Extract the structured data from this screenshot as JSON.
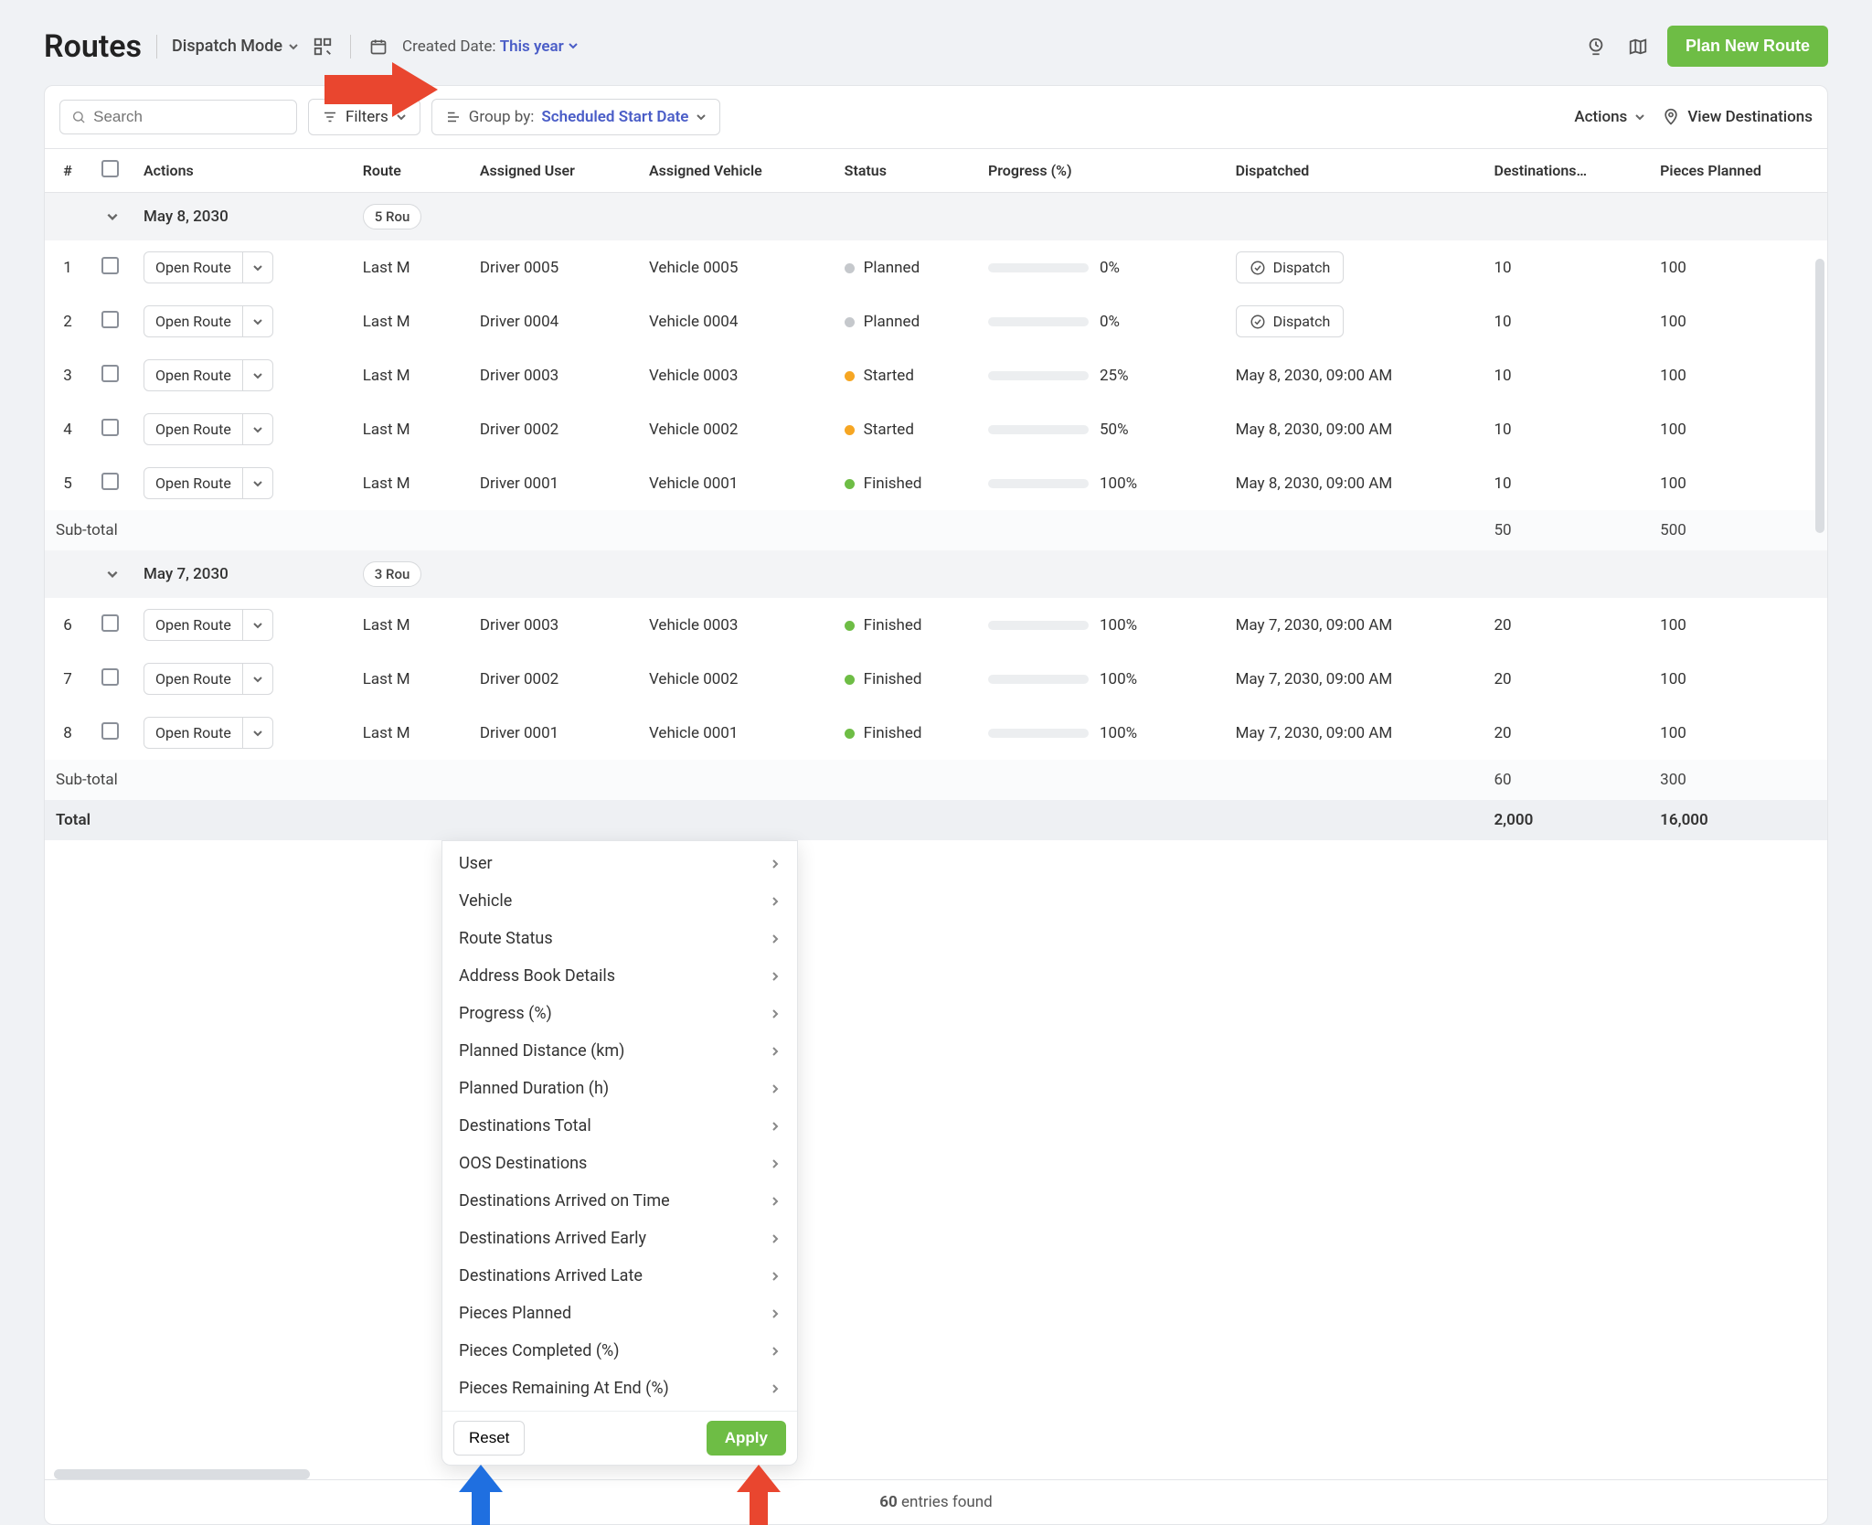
{
  "header": {
    "title": "Routes",
    "dispatch_mode": "Dispatch Mode",
    "created_date_label": "Created Date:",
    "created_date_value": "This year",
    "plan_button": "Plan New Route"
  },
  "toolbar": {
    "search_placeholder": "Search",
    "filters_label": "Filters",
    "groupby_label": "Group by:",
    "groupby_value": "Scheduled Start Date",
    "actions_label": "Actions",
    "view_dest_label": "View Destinations"
  },
  "columns": {
    "num": "#",
    "actions": "Actions",
    "route": "Route",
    "assigned_user": "Assigned User",
    "assigned_vehicle": "Assigned Vehicle",
    "status": "Status",
    "progress": "Progress (%)",
    "dispatched": "Dispatched",
    "destinations": "Destinations…",
    "pieces_planned": "Pieces Planned"
  },
  "filter_menu": {
    "items": [
      "User",
      "Vehicle",
      "Route Status",
      "Address Book Details",
      "Progress (%)",
      "Planned Distance (km)",
      "Planned Duration (h)",
      "Destinations Total",
      "OOS Destinations",
      "Destinations Arrived on Time",
      "Destinations Arrived Early",
      "Destinations Arrived Late",
      "Pieces Planned",
      "Pieces Completed (%)",
      "Pieces Remaining At End (%)"
    ],
    "reset": "Reset",
    "apply": "Apply"
  },
  "groups": [
    {
      "date": "May 8, 2030",
      "count_label": "5 Rou",
      "rows": [
        {
          "n": 1,
          "open": "Open Route",
          "route": "Last M",
          "user": "Driver 0005",
          "vehicle": "Vehicle 0005",
          "status": "Planned",
          "status_dot": "grey",
          "progress": 0,
          "progress_label": "0%",
          "dispatched_btn": "Dispatch",
          "dest": 10,
          "pieces": 100
        },
        {
          "n": 2,
          "open": "Open Route",
          "route": "Last M",
          "user": "Driver 0004",
          "vehicle": "Vehicle 0004",
          "status": "Planned",
          "status_dot": "grey",
          "progress": 0,
          "progress_label": "0%",
          "dispatched_btn": "Dispatch",
          "dest": 10,
          "pieces": 100
        },
        {
          "n": 3,
          "open": "Open Route",
          "route": "Last M",
          "user": "Driver 0003",
          "vehicle": "Vehicle 0003",
          "status": "Started",
          "status_dot": "orange",
          "progress": 25,
          "progress_label": "25%",
          "dispatched": "May 8, 2030, 09:00 AM",
          "dest": 10,
          "pieces": 100
        },
        {
          "n": 4,
          "open": "Open Route",
          "route": "Last M",
          "user": "Driver 0002",
          "vehicle": "Vehicle 0002",
          "status": "Started",
          "status_dot": "orange",
          "progress": 50,
          "progress_label": "50%",
          "dispatched": "May 8, 2030, 09:00 AM",
          "dest": 10,
          "pieces": 100
        },
        {
          "n": 5,
          "open": "Open Route",
          "route": "Last M",
          "user": "Driver 0001",
          "vehicle": "Vehicle 0001",
          "status": "Finished",
          "status_dot": "green",
          "progress": 100,
          "progress_label": "100%",
          "dispatched": "May 8, 2030, 09:00 AM",
          "dest": 10,
          "pieces": 100
        }
      ],
      "subtotal": {
        "label": "Sub-total",
        "dest": 50,
        "pieces": 500
      }
    },
    {
      "date": "May 7, 2030",
      "count_label": "3 Rou",
      "rows": [
        {
          "n": 6,
          "open": "Open Route",
          "route": "Last M",
          "user": "Driver 0003",
          "vehicle": "Vehicle 0003",
          "status": "Finished",
          "status_dot": "green",
          "progress": 100,
          "progress_label": "100%",
          "dispatched": "May 7, 2030, 09:00 AM",
          "dest": 20,
          "pieces": 100
        },
        {
          "n": 7,
          "open": "Open Route",
          "route": "Last M",
          "user": "Driver 0002",
          "vehicle": "Vehicle 0002",
          "status": "Finished",
          "status_dot": "green",
          "progress": 100,
          "progress_label": "100%",
          "dispatched": "May 7, 2030, 09:00 AM",
          "dest": 20,
          "pieces": 100
        },
        {
          "n": 8,
          "open": "Open Route",
          "route": "Last M",
          "user": "Driver 0001",
          "vehicle": "Vehicle 0001",
          "status": "Finished",
          "status_dot": "green",
          "progress": 100,
          "progress_label": "100%",
          "dispatched": "May 7, 2030, 09:00 AM",
          "dest": 20,
          "pieces": 100
        }
      ],
      "subtotal": {
        "label": "Sub-total",
        "dest": 60,
        "pieces": 300
      }
    }
  ],
  "total": {
    "label": "Total",
    "dest": "2,000",
    "pieces": "16,000"
  },
  "footer": {
    "count": "60",
    "label": "entries found"
  }
}
